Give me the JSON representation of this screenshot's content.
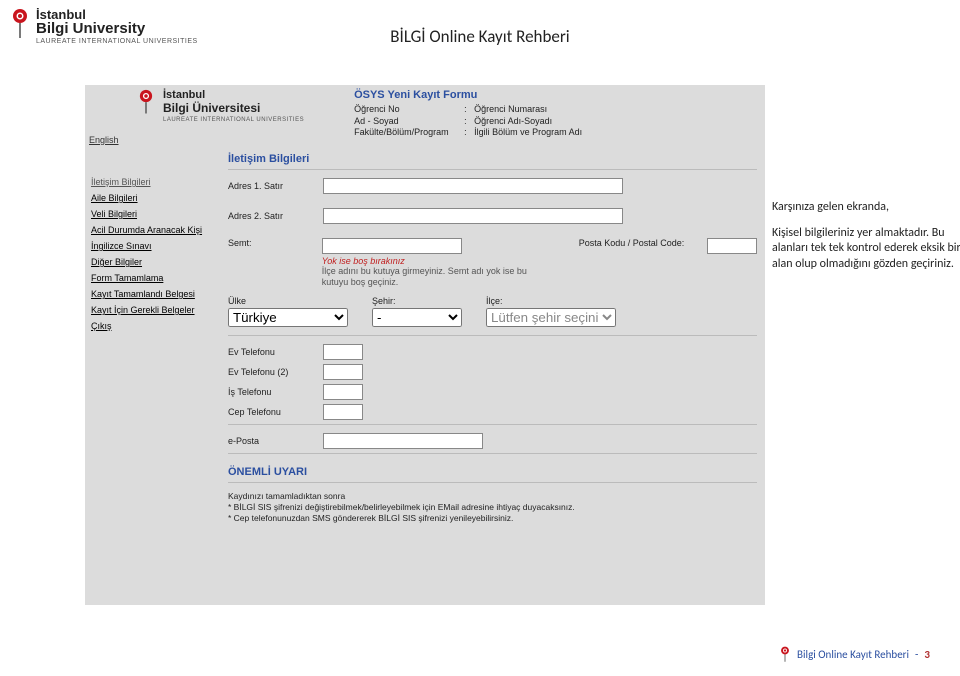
{
  "header": {
    "uni_line1": "İstanbul",
    "uni_line2": "Bilgi University",
    "uni_sub": "LAUREATE INTERNATIONAL UNIVERSITIES",
    "page_title": "BİLGİ Online Kayıt Rehberi"
  },
  "app": {
    "logo": {
      "l1": "İstanbul",
      "l2": "Bilgi Üniversitesi",
      "l3": "LAUREATE INTERNATIONAL UNIVERSITIES"
    },
    "lang_link": "English",
    "form_title": "ÖSYS Yeni Kayıt Formu",
    "info": [
      {
        "label": "Öğrenci No",
        "value": "Öğrenci Numarası"
      },
      {
        "label": "Ad - Soyad",
        "value": "Öğrenci Adı-Soyadı"
      },
      {
        "label": "Fakülte/Bölüm/Program",
        "value": "İlgili Bölüm ve Program Adı"
      }
    ],
    "sidebar": [
      "İletişim Bilgileri",
      "Aile Bilgileri",
      "Veli Bilgileri",
      "Acil Durumda Aranacak Kişi",
      "İngilizce Sınavı",
      "Diğer Bilgiler",
      "Form Tamamlama",
      "Kayıt Tamamlandı Belgesi",
      "Kayıt İçin Gerekli Belgeler",
      "Çıkış"
    ],
    "section_title": "İletişim Bilgileri",
    "labels": {
      "adres1": "Adres 1. Satır",
      "adres2": "Adres 2. Satır",
      "semt": "Semt:",
      "posta": "Posta Kodu / Postal Code:",
      "hint_red": "Yok ise boş bırakınız",
      "hint_grey": "İlçe adını bu kutuya girmeyiniz. Semt adı yok ise bu kutuyu boş geçiniz.",
      "ulke": "Ülke",
      "sehir": "Şehir:",
      "ilce": "İlçe:",
      "ulke_val": "Türkiye",
      "sehir_val": "-",
      "ilce_placeholder": "Lütfen şehir seçini.",
      "evtel": "Ev Telefonu",
      "evtel2": "Ev Telefonu (2)",
      "istel": "İş Telefonu",
      "ceptel": "Cep Telefonu",
      "eposta": "e-Posta"
    },
    "warning": {
      "title": "ÖNEMLİ UYARI",
      "l1": "Kaydınızı tamamladıktan sonra",
      "l2": "* BİLGİ SIS şifrenizi değiştirebilmek/belirleyebilmek için EMail adresine ihtiyaç duyacaksınız.",
      "l3": "* Cep telefonunuzdan SMS göndererek BİLGİ SIS şifrenizi yenileyebilirsiniz."
    }
  },
  "desc": {
    "p1": "Karşınıza gelen ekranda,",
    "p2": "Kişisel bilgileriniz yer almaktadır. Bu alanları tek tek kontrol ederek eksik bir alan olup olmadığını gözden geçiriniz."
  },
  "footer": {
    "text": "Bilgi Online Kayıt Rehberi",
    "sep": "-",
    "page": "3"
  }
}
